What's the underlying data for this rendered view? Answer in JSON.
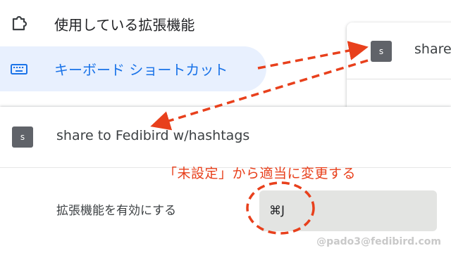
{
  "nav": {
    "extensions_label": "使用している拡張機能",
    "shortcuts_label": "キーボード ショートカット"
  },
  "background_card": {
    "icon_letter": "s",
    "name_partial": "share"
  },
  "extension": {
    "icon_letter": "s",
    "name": "share to Fedibird w/hashtags",
    "action_label": "拡張機能を有効にする",
    "shortcut_value": "⌘J"
  },
  "annotation": {
    "note": "「未設定」から適当に変更する",
    "color": "#e8401c"
  },
  "watermark": "@pado3@fedibird.com",
  "colors": {
    "accent": "#1a73e8",
    "selected_bg": "#e8f0fe",
    "annotation": "#e8401c"
  },
  "icons": [
    "puzzle-icon",
    "keyboard-icon"
  ]
}
